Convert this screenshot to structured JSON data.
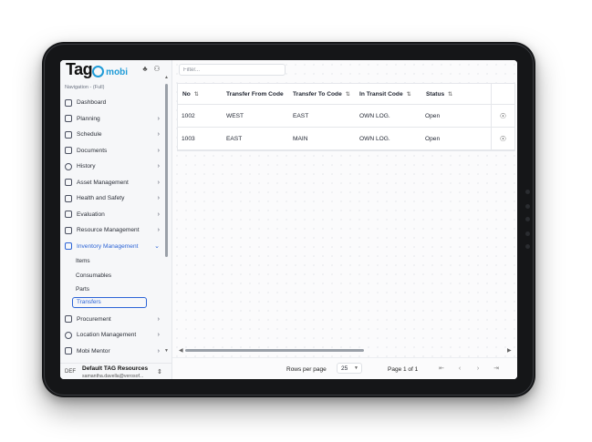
{
  "app": {
    "logo_text": "Tag",
    "logo_sub": "mobi",
    "nav_caption": "Navigation - (Full)"
  },
  "sidebar": {
    "items": [
      {
        "label": "Dashboard",
        "icon": "dashboard-icon",
        "chevron": false
      },
      {
        "label": "Planning",
        "icon": "planning-icon",
        "chevron": true
      },
      {
        "label": "Schedule",
        "icon": "calendar-icon",
        "chevron": true
      },
      {
        "label": "Documents",
        "icon": "documents-icon",
        "chevron": true
      },
      {
        "label": "History",
        "icon": "history-icon",
        "chevron": true
      },
      {
        "label": "Asset Management",
        "icon": "asset-icon",
        "chevron": true
      },
      {
        "label": "Health and Safety",
        "icon": "health-icon",
        "chevron": true
      },
      {
        "label": "Evaluation",
        "icon": "evaluation-icon",
        "chevron": true
      },
      {
        "label": "Resource Management",
        "icon": "resource-icon",
        "chevron": true
      },
      {
        "label": "Inventory Management",
        "icon": "inventory-icon",
        "chevron": true,
        "expanded": true
      }
    ],
    "sub_items": [
      "Items",
      "Consumables",
      "Parts",
      "Transfers"
    ],
    "selected_sub": "Transfers",
    "items_after": [
      {
        "label": "Procurement",
        "icon": "procurement-icon",
        "chevron": true
      },
      {
        "label": "Location Management",
        "icon": "location-icon",
        "chevron": true
      },
      {
        "label": "Mobi Mentor",
        "icon": "mentor-icon",
        "chevron": true
      }
    ]
  },
  "user": {
    "badge": "DEF",
    "name": "Default TAG Resources",
    "email": "samantha.davella@verosof..."
  },
  "filter": {
    "placeholder": "Filter..."
  },
  "table": {
    "columns": [
      "No",
      "Transfer From Code",
      "Transfer To Code",
      "In Transit Code",
      "Status"
    ],
    "rows": [
      [
        "1002",
        "WEST",
        "EAST",
        "OWN LOG.",
        "Open"
      ],
      [
        "1003",
        "EAST",
        "MAIN",
        "OWN LOG.",
        "Open"
      ]
    ]
  },
  "pagination": {
    "rows_per_page_label": "Rows per page",
    "rows_per_page_value": "25",
    "page_text": "Page 1 of 1"
  },
  "colors": {
    "accent": "#2c64d6",
    "brand": "#1f9bd7"
  }
}
